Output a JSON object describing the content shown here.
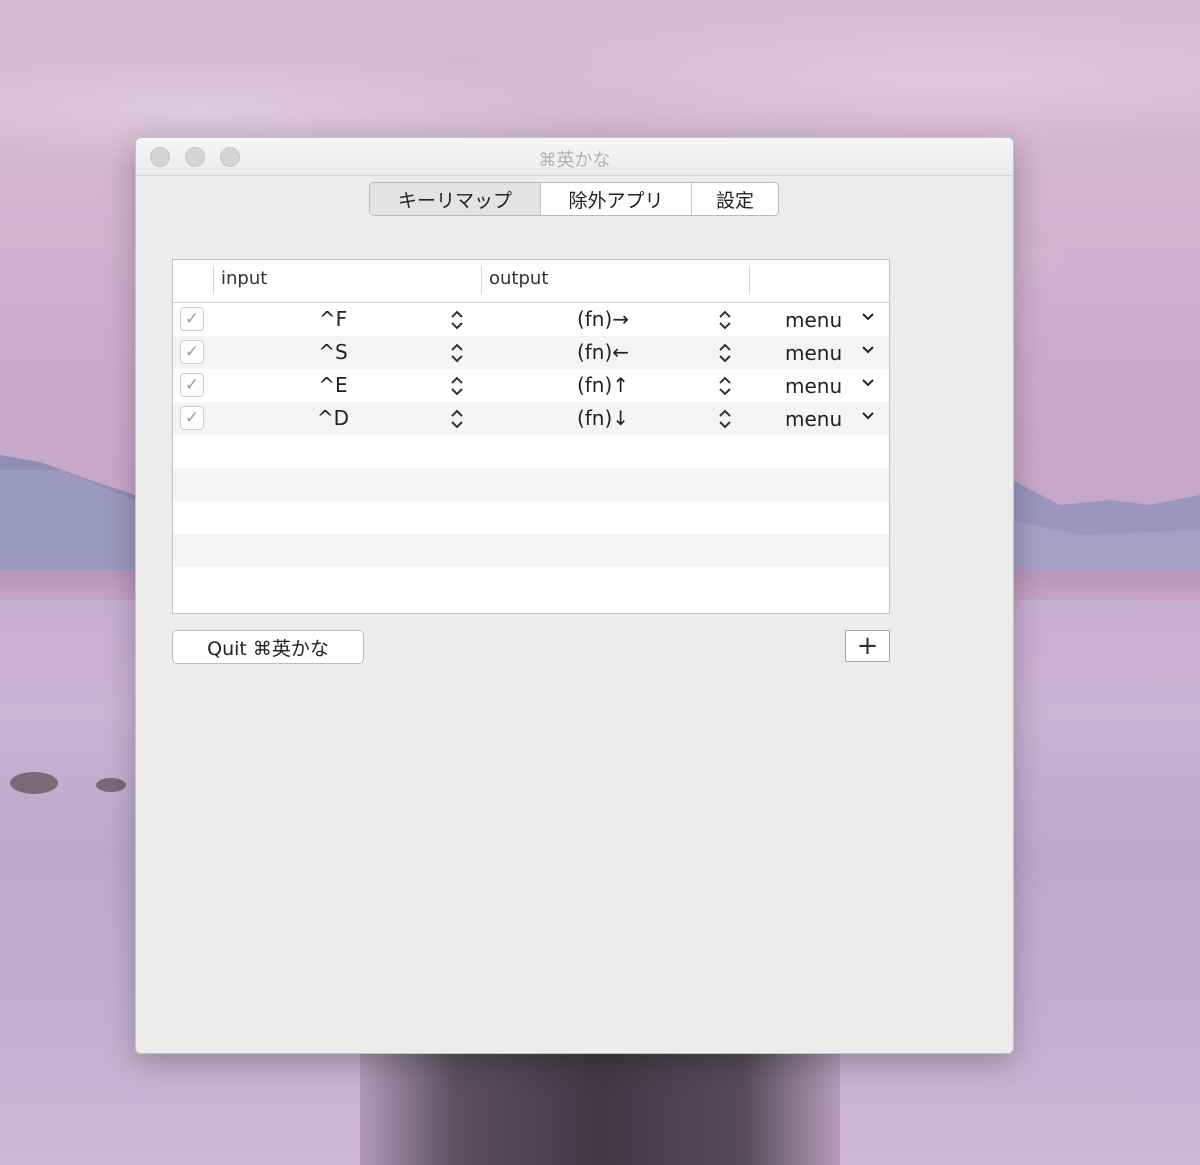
{
  "window": {
    "title": "⌘英かな"
  },
  "tabs": [
    {
      "label": "キーリマップ",
      "active": true
    },
    {
      "label": "除外アプリ",
      "active": false
    },
    {
      "label": "設定",
      "active": false
    }
  ],
  "table": {
    "columns": [
      "input",
      "output"
    ],
    "rows": [
      {
        "enabled": true,
        "input": "^F",
        "output": "(fn)→",
        "menu": "menu"
      },
      {
        "enabled": true,
        "input": "^S",
        "output": "(fn)←",
        "menu": "menu"
      },
      {
        "enabled": true,
        "input": "^E",
        "output": "(fn)↑",
        "menu": "menu"
      },
      {
        "enabled": true,
        "input": "^D",
        "output": "(fn)↓",
        "menu": "menu"
      }
    ],
    "check_glyph": "✓"
  },
  "buttons": {
    "quit_label": "Quit ⌘英かな",
    "add_label": "+"
  }
}
